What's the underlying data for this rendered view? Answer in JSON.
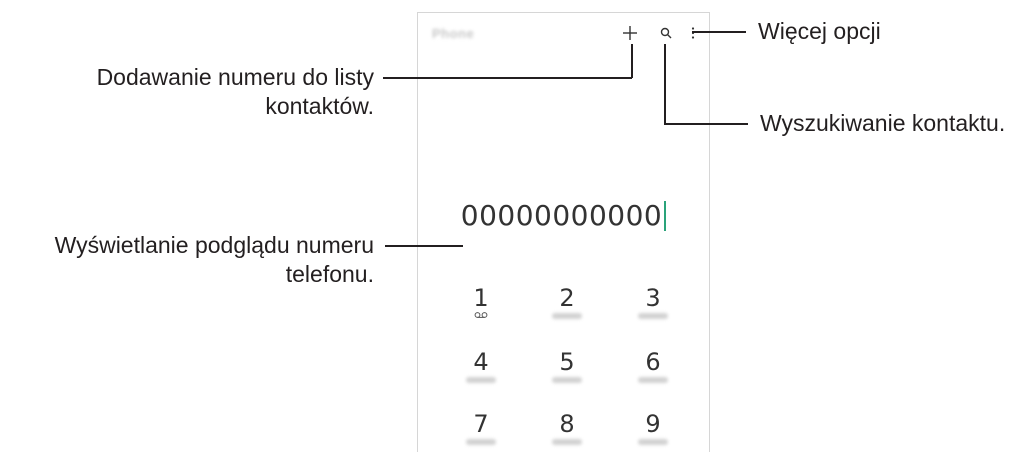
{
  "phone": {
    "app_title": "Phone",
    "number": "00000000000",
    "keypad": [
      {
        "digit": "1",
        "voicemail": true
      },
      {
        "digit": "2"
      },
      {
        "digit": "3"
      },
      {
        "digit": "4"
      },
      {
        "digit": "5"
      },
      {
        "digit": "6"
      },
      {
        "digit": "7"
      },
      {
        "digit": "8"
      },
      {
        "digit": "9"
      }
    ],
    "icons": {
      "add": "plus-icon",
      "search": "search-icon",
      "more": "more-options-icon",
      "voicemail": "voicemail-icon"
    },
    "cursor_color": "#2aa37a"
  },
  "callouts": {
    "more_options": "Więcej opcji",
    "add_contact_line1": "Dodawanie numeru do listy",
    "add_contact_line2": "kontaktów.",
    "search_contact": "Wyszukiwanie kontaktu.",
    "preview_line1": "Wyświetlanie podglądu numeru",
    "preview_line2": "telefonu."
  }
}
